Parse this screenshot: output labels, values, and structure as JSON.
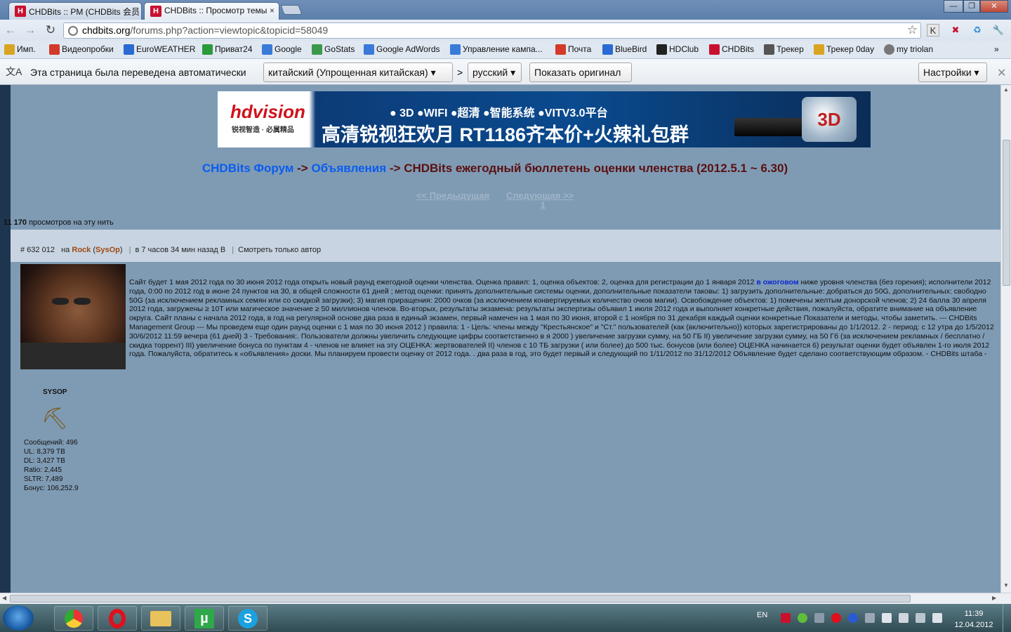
{
  "tabs": [
    {
      "title": "CHDBits :: PM (CHDBits 会员",
      "icon": "H"
    },
    {
      "title": "CHDBits :: Просмотр темы",
      "icon": "H"
    }
  ],
  "window_buttons": {
    "minimize": "—",
    "maximize": "❐",
    "close": "✕"
  },
  "address": {
    "host": "chdbits.org",
    "path": "/forums.php?action=viewtopic&topicid=58049"
  },
  "bookmarks": [
    {
      "label": "Имп.",
      "color": "#d9a520"
    },
    {
      "label": "Видеопробки",
      "color": "#d33a2a"
    },
    {
      "label": "EuroWEATHER",
      "color": "#2a6ad3"
    },
    {
      "label": "Приват24",
      "color": "#2a9a3a"
    },
    {
      "label": "Google",
      "color": "#3a7ad9"
    },
    {
      "label": "GoStats",
      "color": "#3a9a4a"
    },
    {
      "label": "Google AdWords",
      "color": "#3a7ad9"
    },
    {
      "label": "Управление кампа...",
      "color": "#3a7ad9"
    },
    {
      "label": "Почта",
      "color": "#d33a2a"
    },
    {
      "label": "BlueBird",
      "color": "#2a6ad3"
    },
    {
      "label": "HDClub",
      "color": "#222222"
    },
    {
      "label": "CHDBits",
      "color": "#c8102e"
    },
    {
      "label": "Трекер",
      "color": "#555555"
    },
    {
      "label": "Трекер 0day",
      "color": "#d9a520"
    },
    {
      "label": "my triolan",
      "color": "#777777"
    }
  ],
  "translate_bar": {
    "message": "Эта страница была переведена автоматически",
    "from_language": "китайский (Упрощенная китайская)",
    "arrow": ">",
    "to_language": "русский",
    "show_original": "Показать оригинал",
    "settings": "Настройки"
  },
  "banner": {
    "logo": "hdvision",
    "logo_sub": "锐视智造 · 必属精品",
    "line1": "● 3D  ●WIFI  ●超清  ●智能系统  ●VITV3.0平台",
    "line2": "高清锐视狂欢月  RT1186齐本价+火辣礼包群",
    "badge": "3D"
  },
  "breadcrumb": {
    "forum": "CHDBits Форум",
    "arrow": " -> ",
    "section": "Объявления",
    "topic": "CHDBits ежегодный бюллетень оценки членства (2012.5.1 ~ 6.30)"
  },
  "pager": {
    "prev": "<< Предыдущая",
    "next": "Следующая >>",
    "page": "1"
  },
  "views": {
    "count": "11 170",
    "label": " просмотров на эту нить"
  },
  "post": {
    "id": "# 632 012",
    "by": "на",
    "author": "Rock",
    "role": "SysOp",
    "time": "в 7 часов 34 мин назад В",
    "author_only": "Смотреть только автор",
    "rank_title": "SYSOP",
    "stats": {
      "posts": "Сообщений: 496",
      "ul": "UL: 8,379 TB",
      "dl": "DL: 3,427 TB",
      "ratio": "Ratio: 2,445",
      "sltr": "SLTR: 7,489",
      "bonus": "Бонус: 106,252.9"
    },
    "body_before": "Сайт будет 1 мая 2012 года по 30 июня 2012 года открыть новый раунд ежегодной оценки членства. Оценка правил:     1, оценка объектов:     2, оценка для регистрации до 1 января 2012 ",
    "body_link": "в ожоговом",
    "body_after": " ниже уровня членства (без горения); исполнители 2012 года, 0:00 по 2012 год в июне 24 пунктов на 30, в общей сложности 61 дней     ; метод оценки: принять дополнительные системы оценки, дополнительные показатели таковы:        1) загрузить дополнительные: добраться до 50G, дополнительных: свободно 50G (за исключением рекламных семян или со скидкой загрузки);        3) магия приращения: 2000 очков (за исключением конвертируемых количество очков магии).     Освобождение объектов:        1) помечены желтым донорской членов;       2) 24 балла 30 апреля 2012 года, загружены ≥ 10T или магическое значение ≥ 50 миллионов членов. Во-вторых, результаты экзамена:     результаты экспертизы объявил 1 июля 2012 года и выполняет конкретные действия, пожалуйста, обратите внимание на объявление округа.     Сайт планы с начала 2012 года, в год на регулярной основе два раза в единый экзамен, первый намечен на 1 мая по 30 июня, второй с 1 ноября по 31 декабря каждый оценки конкретные Показатели и методы, чтобы заметить.                                                                       --- CHDBits Management Group --- Мы проведем еще один раунд оценки с 1 мая по 30 июня 2012 ) правила:       1 - Цель: члены между \"Крестьянское\" и \"Ст.\" пользователей (как (включительно)) которых зарегистрированы до 1/1/2012.        2 - период: с 12 утра до 1/5/2012 30/6/2012 11:59 вечера (61 дней)        3 - Требования:. Пользователи должны увеличить следующие цифры соответственно в      я             2000 ) увеличение загрузки сумму, на 50 ГБ            II) увеличение загрузки сумму, на 50 Гб (за исключением рекламных / бесплатно / скидка торрент) III) увеличение бонуса по пунктам        4 - членов не влияет на эту ОЦЕНКА:          жертвователей            II) членов с 10 ТБ загрузки ( или более) до 500 тыс. бонусов (или более) ОЦЕНКА начинается 6) результат оценки будет объявлен 1-го июля 2012 года. Пожалуйста, обратитесь к «объявления» доски. Мы планируем провести оценку от 2012 года. . два раза в год, это будет первый и следующий по 1/11/2012 по 31/12/2012 Объявление будет сделано соответствующим образом.                                                                                                                         - CHDBits штаба -"
  },
  "taskbar": {
    "apps": [
      "chrome",
      "opera",
      "explorer",
      "utorrent",
      "skype"
    ],
    "lang": "EN",
    "time": "11:39",
    "date": "12.04.2012"
  }
}
